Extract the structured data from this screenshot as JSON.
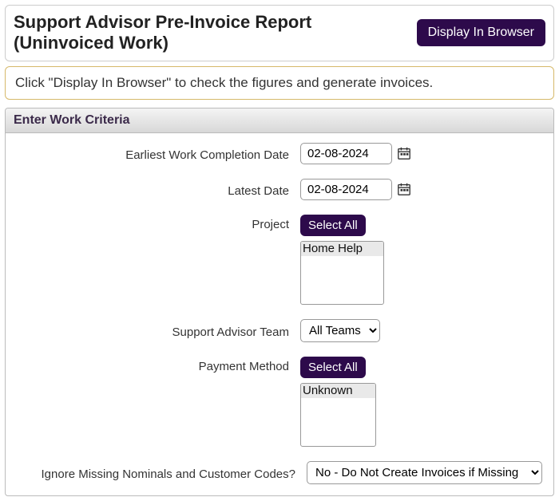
{
  "header": {
    "title": "Support Advisor Pre-Invoice Report (Uninvoiced Work)",
    "display_button": "Display In Browser"
  },
  "info": {
    "message": "Click \"Display In Browser\" to check the figures and generate invoices."
  },
  "criteria": {
    "title": "Enter Work Criteria",
    "earliest": {
      "label": "Earliest Work Completion Date",
      "value": "02-08-2024"
    },
    "latest": {
      "label": "Latest Date",
      "value": "02-08-2024"
    },
    "project": {
      "label": "Project",
      "select_all": "Select All",
      "options": [
        "Home Help"
      ]
    },
    "team": {
      "label": "Support Advisor Team",
      "selected": "All Teams"
    },
    "payment": {
      "label": "Payment Method",
      "select_all": "Select All",
      "options": [
        "Unknown"
      ]
    },
    "ignore_missing": {
      "label": "Ignore Missing Nominals and Customer Codes?",
      "selected": "No - Do Not Create Invoices if Missing"
    }
  }
}
